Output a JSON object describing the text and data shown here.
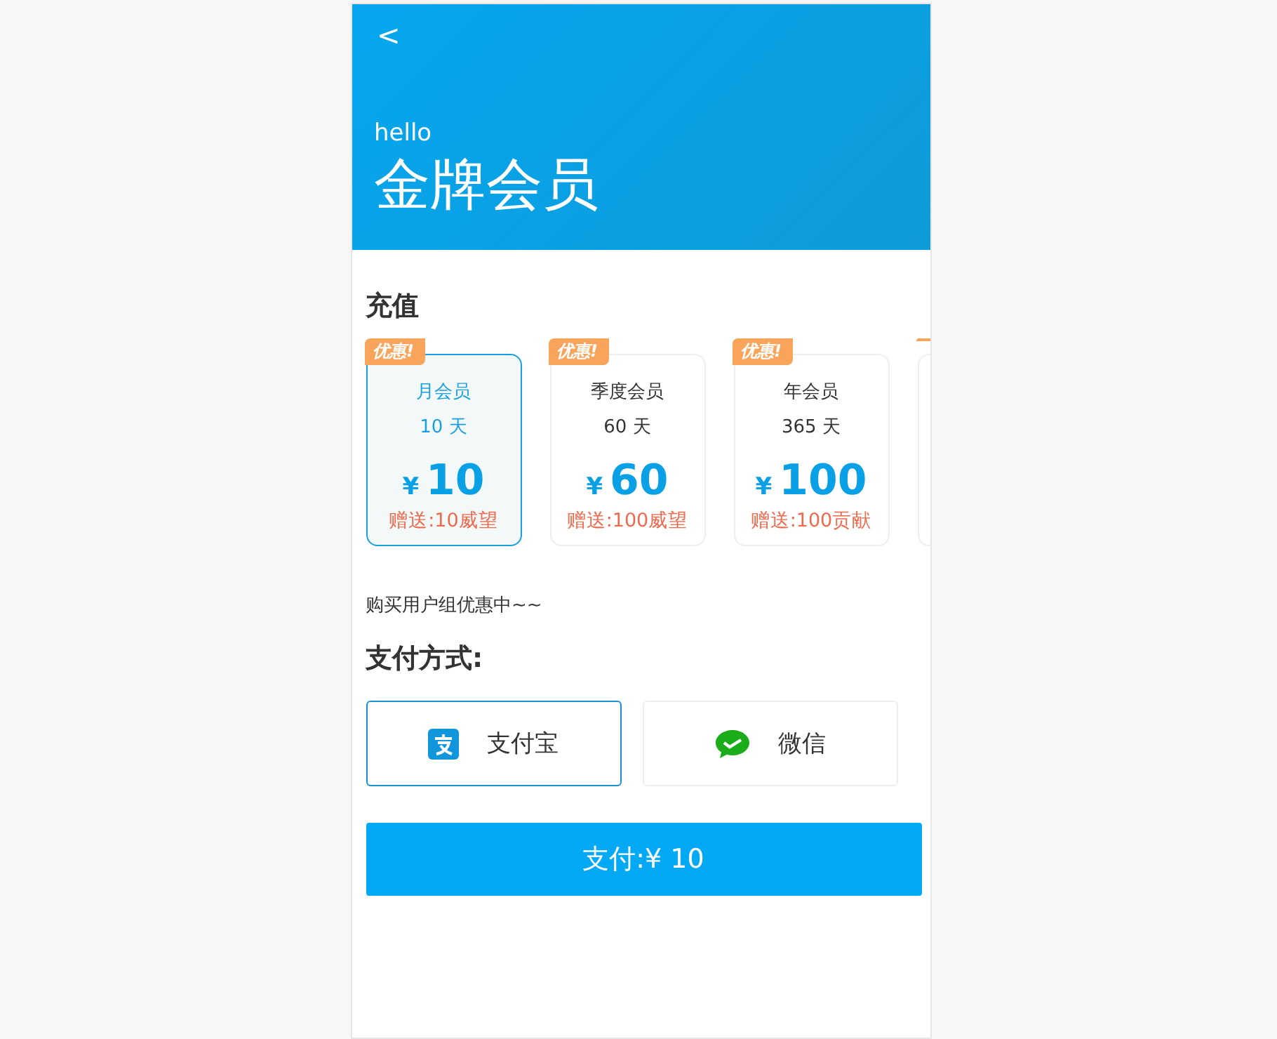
{
  "header": {
    "back_icon": "<",
    "greeting": "hello",
    "title": "金牌会员"
  },
  "recharge": {
    "title": "充值",
    "plans": [
      {
        "badge": "优惠!",
        "name": "月会员",
        "days": "10 天",
        "currency": "¥",
        "price": "10",
        "bonus": "赠送:10威望",
        "selected": true
      },
      {
        "badge": "优惠!",
        "name": "季度会员",
        "days": "60 天",
        "currency": "¥",
        "price": "60",
        "bonus": "赠送:100威望",
        "selected": false
      },
      {
        "badge": "优惠!",
        "name": "年会员",
        "days": "365 天",
        "currency": "¥",
        "price": "100",
        "bonus": "赠送:100贡献",
        "selected": false
      },
      {
        "selected": false
      }
    ],
    "note": "购买用户组优惠中~~"
  },
  "payment": {
    "title": "支付方式:",
    "methods": [
      {
        "kind": "alipay",
        "label": "支付宝",
        "selected": true
      },
      {
        "kind": "wechat",
        "label": "微信",
        "selected": false
      }
    ]
  },
  "pay_button": "支付:¥ 10"
}
